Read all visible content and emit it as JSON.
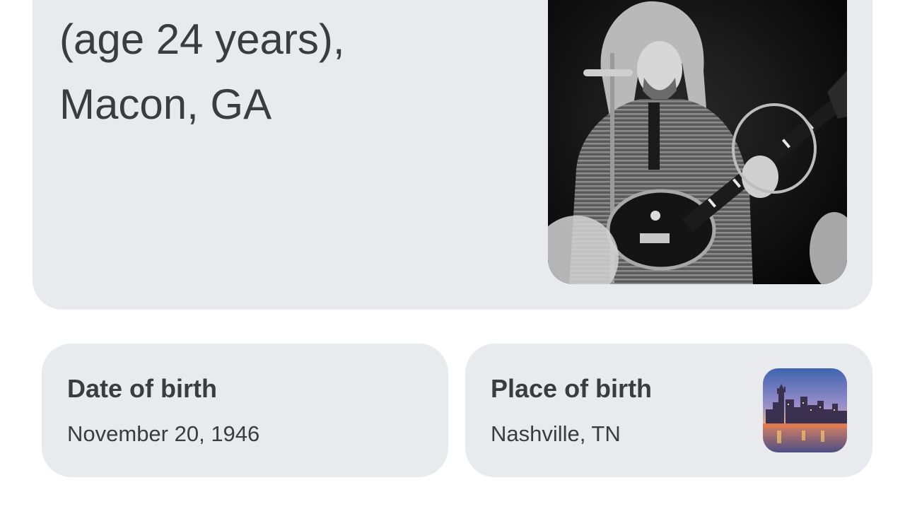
{
  "death": {
    "age_line": "(age 24 years),",
    "place_line": "Macon, GA"
  },
  "birth_date": {
    "label": "Date of birth",
    "value": "November 20, 1946"
  },
  "birth_place": {
    "label": "Place of birth",
    "value": "Nashville, TN"
  },
  "images": {
    "portrait": "musician-with-guitar-photo",
    "place": "nashville-skyline-thumbnail"
  }
}
